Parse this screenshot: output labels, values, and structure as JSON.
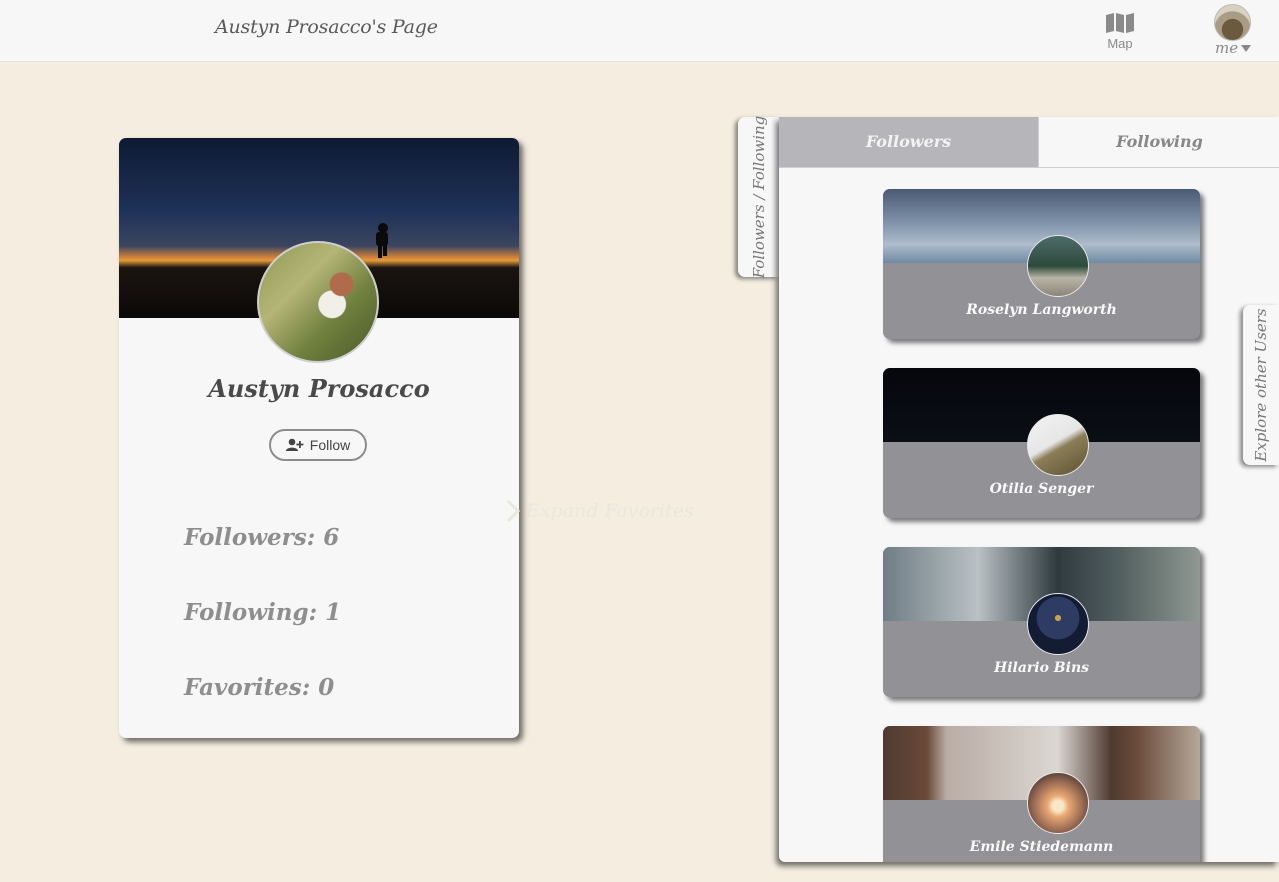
{
  "header": {
    "page_title": "Austyn Prosacco's Page",
    "map_label": "Map",
    "me_label": "me"
  },
  "profile": {
    "name": "Austyn Prosacco",
    "follow_label": "Follow",
    "stats": {
      "followers_label": "Followers:",
      "followers_value": "6",
      "following_label": "Following:",
      "following_value": "1",
      "favorites_label": "Favorites:",
      "favorites_value": "0"
    },
    "expand_label": "Expand Favorites"
  },
  "panel": {
    "side_tab_label": "Followers / Following",
    "tabs": [
      {
        "label": "Followers",
        "active": true
      },
      {
        "label": "Following",
        "active": false
      }
    ],
    "users": [
      {
        "name": "Roselyn Langworth"
      },
      {
        "name": "Otilia Senger"
      },
      {
        "name": "Hilario Bins"
      },
      {
        "name": "Emile Stiedemann"
      }
    ]
  },
  "explore_tab_label": "Explore other Users",
  "icons": {
    "map": "map-icon",
    "caret": "caret-down-icon",
    "follow": "user-plus-icon",
    "chevron": "chevron-right-icon"
  }
}
